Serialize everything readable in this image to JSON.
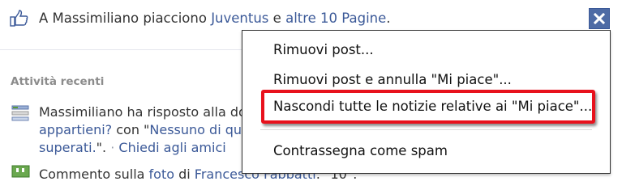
{
  "story": {
    "prefix": "A Massimiliano piacciono ",
    "link1": "Juventus",
    "mid": " e ",
    "link2": "altre 10 Pagine",
    "suffix": "."
  },
  "recent": {
    "label": "Attività recenti"
  },
  "activity": {
    "line1": "Massimiliano ha risposto alla do",
    "line2_link1": "appartieni?",
    "line2_text": " con \"",
    "line2_link2": "Nessuno di qu",
    "line3_link": "superati.",
    "line3_text": "\".",
    "line3_sep": " · ",
    "line3_action": "Chiedi agli amici"
  },
  "activity2": {
    "prefix": "Commento sulla ",
    "link1": "foto",
    "mid": " di ",
    "link2": "Francesco Fabbatti",
    "suffix": ": \"10\"."
  },
  "menu": {
    "items": [
      "Rimuovi post...",
      "Rimuovi post e annulla \"Mi piace\"...",
      "Nascondi tutte le notizie relative ai \"Mi piace\"...",
      "Contrassegna come spam"
    ]
  },
  "colors": {
    "link": "#3b5998",
    "highlight": "#e8111c",
    "close_button": "#4e6ba5"
  }
}
